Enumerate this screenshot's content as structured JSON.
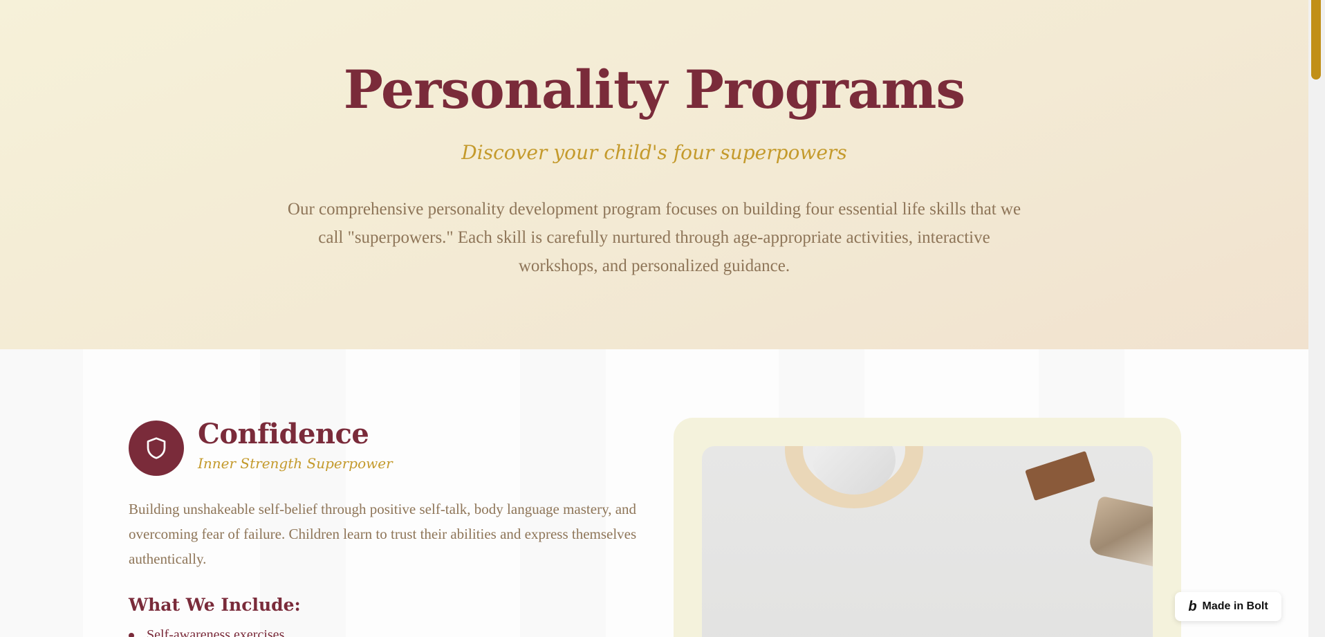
{
  "hero": {
    "title": "Personality Programs",
    "subtitle": "Discover your child's four superpowers",
    "description": "Our comprehensive personality development program focuses on building four essential life skills that we call \"superpowers.\" Each skill is carefully nurtured through age-appropriate activities, interactive workshops, and personalized guidance."
  },
  "feature": {
    "icon": "shield-icon",
    "title": "Confidence",
    "tagline": "Inner Strength Superpower",
    "description": "Building unshakeable self-belief through positive self-talk, body language mastery, and overcoming fear of failure. Children learn to trust their abilities and express themselves authentically.",
    "include_heading": "What We Include:",
    "include_items": [
      "Self-awareness exercises"
    ]
  },
  "badge": {
    "label": "Made in Bolt",
    "icon": "bolt-logo-icon"
  },
  "colors": {
    "primary": "#7a2b3a",
    "accent": "#c49a2c",
    "body_text": "#8e7558",
    "scroll_thumb": "#c18f17"
  }
}
